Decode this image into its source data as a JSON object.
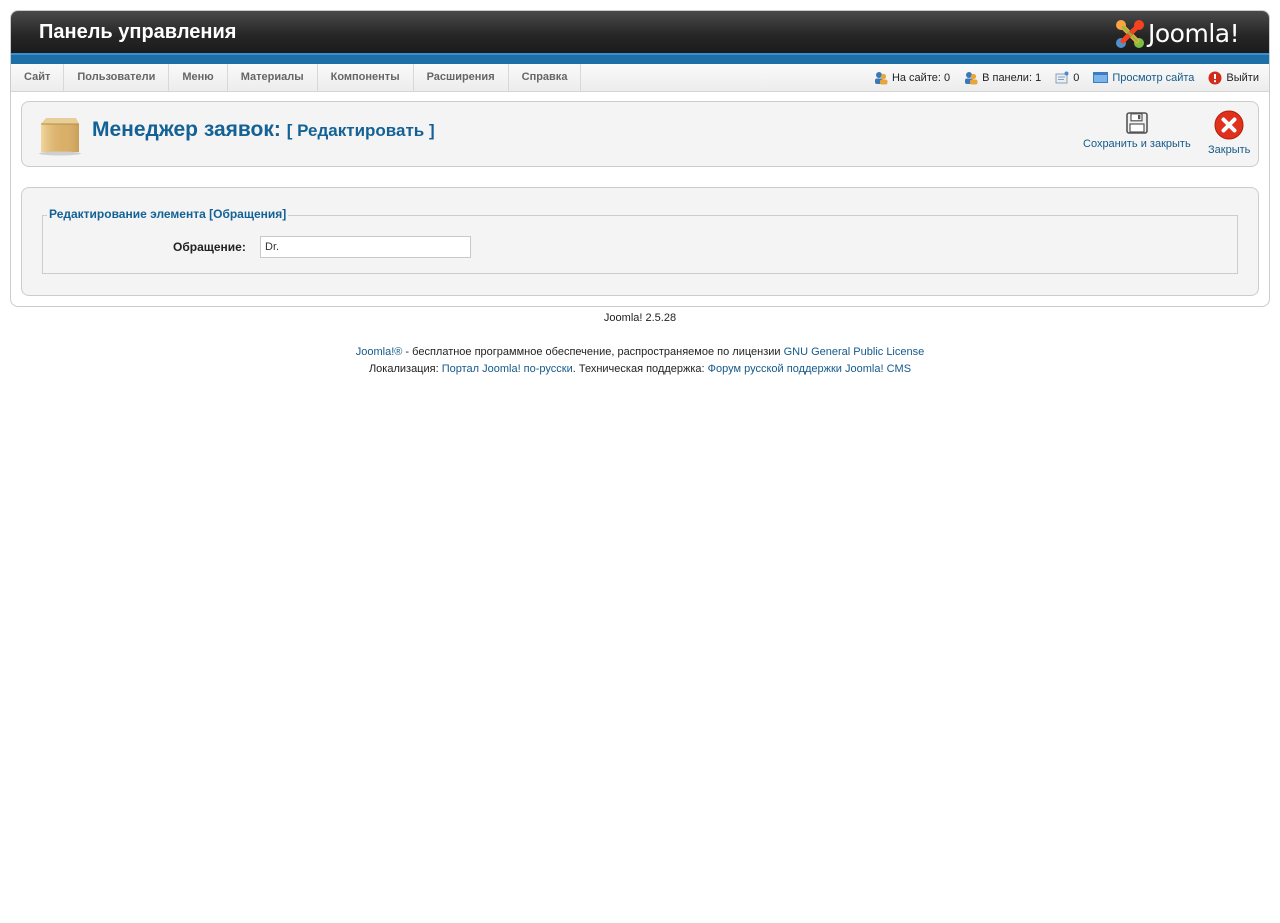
{
  "header": {
    "title": "Панель управления",
    "logo_text": "Joomla!",
    "accent_color": "#1c6fa7"
  },
  "menu": {
    "items": [
      {
        "label": "Сайт"
      },
      {
        "label": "Пользователи"
      },
      {
        "label": "Меню"
      },
      {
        "label": "Материалы"
      },
      {
        "label": "Компоненты"
      },
      {
        "label": "Расширения"
      },
      {
        "label": "Справка"
      }
    ]
  },
  "status": {
    "on_site_label": "На сайте:",
    "on_site_count": "0",
    "in_panel_label": "В панели:",
    "in_panel_count": "1",
    "messages_count": "0",
    "view_site": "Просмотр сайта",
    "logout": "Выйти"
  },
  "toolbar": {
    "title": "Менеджер заявок:",
    "subtitle": "[ Редактировать ]",
    "save_close_label": "Сохранить и закрыть",
    "close_label": "Закрыть"
  },
  "form": {
    "legend": "Редактирование элемента [Обращения]",
    "field_label": "Обращение:",
    "field_value": "Dr."
  },
  "footer": {
    "version": "Joomla! 2.5.28",
    "line1_link1": "Joomla!®",
    "line1_text": " - бесплатное программное обеспечение, распространяемое по лицензии ",
    "line1_link2": "GNU General Public License",
    "line2_text1": "Локализация: ",
    "line2_link1": "Портал Joomla! по-русски",
    "line2_text2": ". Техническая поддержка: ",
    "line2_link2": "Форум русской поддержки Joomla! CMS"
  }
}
